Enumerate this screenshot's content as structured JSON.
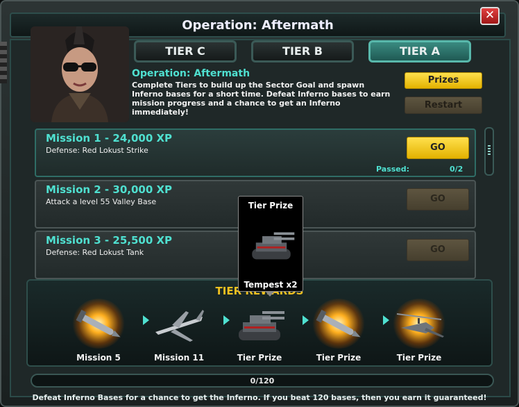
{
  "window": {
    "title": "Operation: Aftermath",
    "close_glyph": "✕"
  },
  "tabs": [
    {
      "label": "TIER C",
      "active": false
    },
    {
      "label": "TIER B",
      "active": false
    },
    {
      "label": "TIER A",
      "active": true
    }
  ],
  "operation": {
    "title": "Operation: Aftermath",
    "description": "Complete Tiers to build up the Sector Goal and spawn Inferno bases for a short time. Defeat Inferno bases to earn mission progress and a chance to get an Inferno immediately!"
  },
  "buttons": {
    "prizes": "Prizes",
    "restart": "Restart"
  },
  "missions": [
    {
      "title": "Mission 1 - 24,000 XP",
      "subtitle": "Defense: Red Lokust Strike",
      "go": "GO",
      "enabled": true,
      "passed_label": "Passed:",
      "passed_value": "0/2"
    },
    {
      "title": "Mission 2 - 30,000 XP",
      "subtitle": "Attack a level 55 Valley Base",
      "go": "GO",
      "enabled": false
    },
    {
      "title": "Mission 3 - 25,500 XP",
      "subtitle": "Defense: Red Lokust Tank",
      "go": "GO",
      "enabled": false
    }
  ],
  "tier_rewards": {
    "title": "TIER REWARDS",
    "items": [
      {
        "label": "Mission 5",
        "icon": "missile-icon"
      },
      {
        "label": "Mission 11",
        "icon": "jet-icon"
      },
      {
        "label": "Tier Prize",
        "icon": "tank-icon"
      },
      {
        "label": "Tier Prize",
        "icon": "missile-icon"
      },
      {
        "label": "Tier Prize",
        "icon": "helicopter-icon"
      }
    ]
  },
  "tooltip": {
    "header": "Tier Prize",
    "footer": "Tempest x2",
    "icon": "tank-icon"
  },
  "progress": {
    "text": "0/120",
    "fraction": 0.0
  },
  "footer": "Defeat Inferno Bases for a chance to get the Inferno. If you beat 120 bases, then you earn it guaranteed!",
  "colors": {
    "accent": "#4fe0d0",
    "button_yellow": "#f5c518",
    "close_red": "#c82020"
  }
}
